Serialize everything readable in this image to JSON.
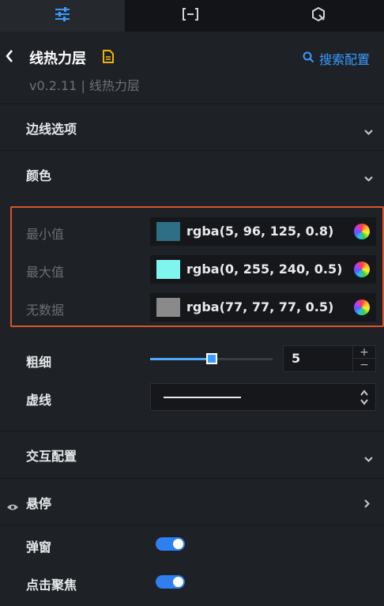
{
  "toolbar": {
    "tabs": [
      {
        "icon": "sliders-icon",
        "active": true
      },
      {
        "icon": "bracket-minus-icon",
        "active": false
      },
      {
        "icon": "interaction-icon",
        "active": false
      }
    ]
  },
  "header": {
    "title": "线热力层",
    "search_label": "搜索配置",
    "version": "v0.2.11 | 线热力层"
  },
  "sections": {
    "edge_options": "边线选项",
    "color": "颜色",
    "interaction": "交互配置",
    "hover": "悬停"
  },
  "colors": [
    {
      "label": "最小值",
      "value": "rgba(5, 96, 125, 0.8)",
      "swatch": "#2f6f85"
    },
    {
      "label": "最大值",
      "value": "rgba(0, 255, 240, 0.5)",
      "swatch": "#7ff5ee"
    },
    {
      "label": "无数据",
      "value": "rgba(77, 77, 77, 0.5)",
      "swatch": "#8a8a8a"
    }
  ],
  "thickness": {
    "label": "粗细",
    "value": "5",
    "fraction": 0.5
  },
  "dash": {
    "label": "虚线"
  },
  "toggles": [
    {
      "label": "弹窗",
      "on": true
    },
    {
      "label": "点击聚焦",
      "on": true
    }
  ],
  "theme": {
    "accent": "#3b9cff",
    "highlight_border": "#d9542b"
  }
}
